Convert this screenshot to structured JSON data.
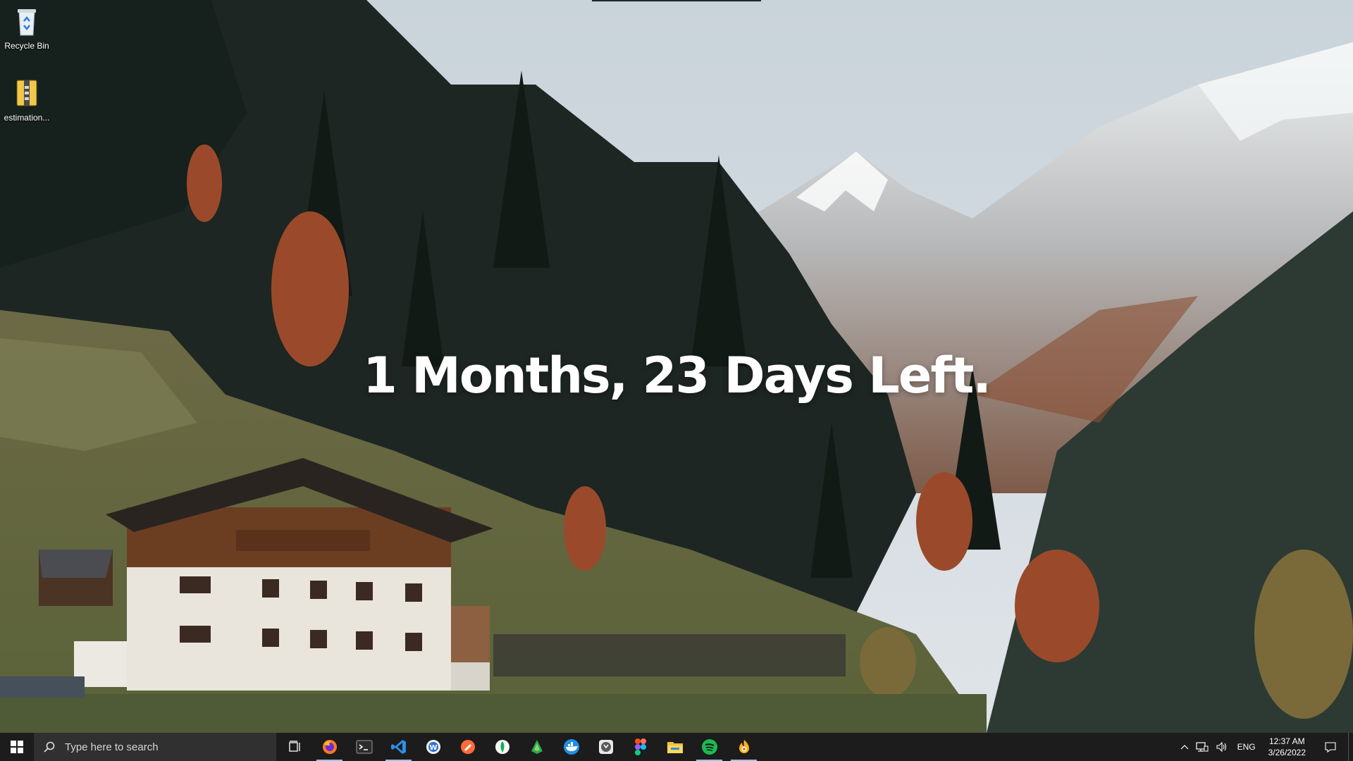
{
  "desktop": {
    "countdown_text": "1 Months, 23 Days Left.",
    "icons": [
      {
        "label": "Recycle Bin",
        "icon": "recycle-bin-icon"
      },
      {
        "label": "estimation...",
        "icon": "archive-file-icon"
      }
    ]
  },
  "taskbar": {
    "search_placeholder": "Type here to search",
    "pinned": [
      {
        "name": "task-view",
        "icon": "task-view-icon",
        "running": false
      },
      {
        "name": "firefox",
        "icon": "firefox-icon",
        "running": true
      },
      {
        "name": "terminal",
        "icon": "terminal-icon",
        "running": false
      },
      {
        "name": "vscode",
        "icon": "vscode-icon",
        "running": true
      },
      {
        "name": "app-blue-w",
        "icon": "blue-w-icon",
        "running": false
      },
      {
        "name": "postman",
        "icon": "postman-icon",
        "running": false
      },
      {
        "name": "mongodb-compass",
        "icon": "leaf-icon",
        "running": false
      },
      {
        "name": "app-green",
        "icon": "green-app-icon",
        "running": false
      },
      {
        "name": "docker",
        "icon": "docker-icon",
        "running": false
      },
      {
        "name": "github-desktop",
        "icon": "github-desktop-icon",
        "running": false
      },
      {
        "name": "figma",
        "icon": "figma-icon",
        "running": false
      },
      {
        "name": "file-explorer",
        "icon": "folder-icon",
        "running": false
      },
      {
        "name": "spotify",
        "icon": "spotify-icon",
        "running": true
      },
      {
        "name": "app-orange",
        "icon": "orange-flame-icon",
        "running": true
      }
    ],
    "tray": {
      "language": "ENG",
      "time": "12:37 AM",
      "date": "3/26/2022"
    }
  },
  "colors": {
    "taskbar_bg": "#1c1c1c",
    "search_bg": "#303030",
    "accent_running": "#9ac2ea",
    "countdown_text": "#ffffff"
  }
}
